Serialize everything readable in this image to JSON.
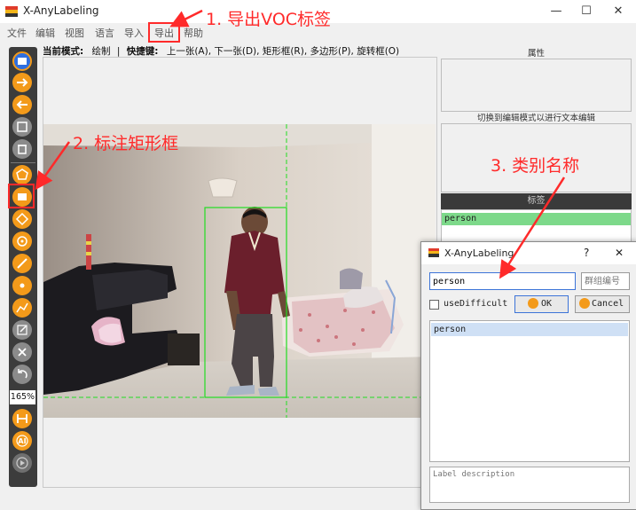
{
  "window": {
    "title": "X-AnyLabeling",
    "minimize_glyph": "—",
    "maximize_glyph": "☐",
    "close_glyph": "✕"
  },
  "menu": [
    "文件",
    "编辑",
    "视图",
    "语言",
    "导入",
    "导出",
    "帮助"
  ],
  "mode_bar": {
    "mode_label": "当前模式:",
    "mode_value": "绘制",
    "separator": "|",
    "shortcut_label": "快捷键:",
    "shortcuts": "上一张(A), 下一张(D), 矩形框(R), 多边形(P), 旋转框(O)"
  },
  "toolbar": {
    "zoom": "165%",
    "icons": [
      "open-dir-icon",
      "next-image-icon",
      "prev-image-icon",
      "save-icon",
      "delete-icon",
      "polygon-icon",
      "rectangle-icon",
      "rotation-icon",
      "circle-icon",
      "line-icon",
      "point-icon",
      "linestrip-icon",
      "edit-icon",
      "remove-icon",
      "undo-icon",
      "fit-width-icon",
      "ai-icon",
      "run-icon"
    ]
  },
  "right_panel": {
    "properties_title": "属性",
    "edit_hint": "切换到编辑模式以进行文本编辑",
    "labels_title": "标签",
    "labels": [
      "person"
    ]
  },
  "dialog": {
    "title": "X-AnyLabeling",
    "help_glyph": "?",
    "close_glyph": "✕",
    "label_value": "person",
    "group_placeholder": "群组编号",
    "use_difficult": "useDifficult",
    "ok_label": "OK",
    "cancel_label": "Cancel",
    "label_list": [
      "person"
    ],
    "description_placeholder": "Label description"
  },
  "annotations": {
    "step1": "1. 导出VOC标签",
    "step2": "2. 标注矩形框",
    "step3": "3. 类别名称"
  },
  "colors": {
    "annotation_red": "#ff2a2a",
    "toolbar_orange": "#f39a1a",
    "label_green": "#7dd98a",
    "bbox_green": "#22dd22"
  }
}
